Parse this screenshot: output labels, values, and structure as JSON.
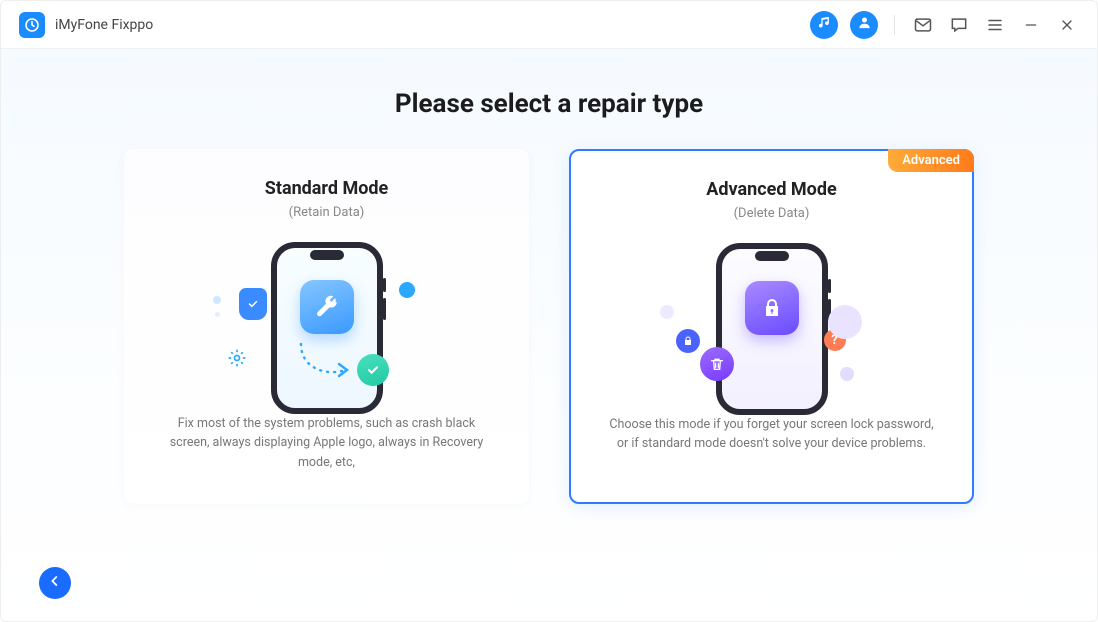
{
  "app": {
    "title": "iMyFone Fixppo"
  },
  "page": {
    "heading": "Please select a repair type"
  },
  "titlebar_icons": {
    "music": "music-icon",
    "account": "account-icon",
    "mail": "mail-icon",
    "feedback": "feedback-icon",
    "menu": "menu-icon",
    "minimize": "minimize-icon",
    "close": "close-icon"
  },
  "cards": {
    "standard": {
      "title": "Standard Mode",
      "subtitle": "(Retain Data)",
      "description": "Fix most of the system problems, such as crash black screen, always displaying Apple logo, always in Recovery mode, etc,"
    },
    "advanced": {
      "title": "Advanced Mode",
      "subtitle": "(Delete Data)",
      "description": "Choose this mode if you forget your screen lock password, or if standard mode doesn't solve your device problems.",
      "badge": "Advanced"
    }
  },
  "back_button": {
    "label": "Back"
  }
}
